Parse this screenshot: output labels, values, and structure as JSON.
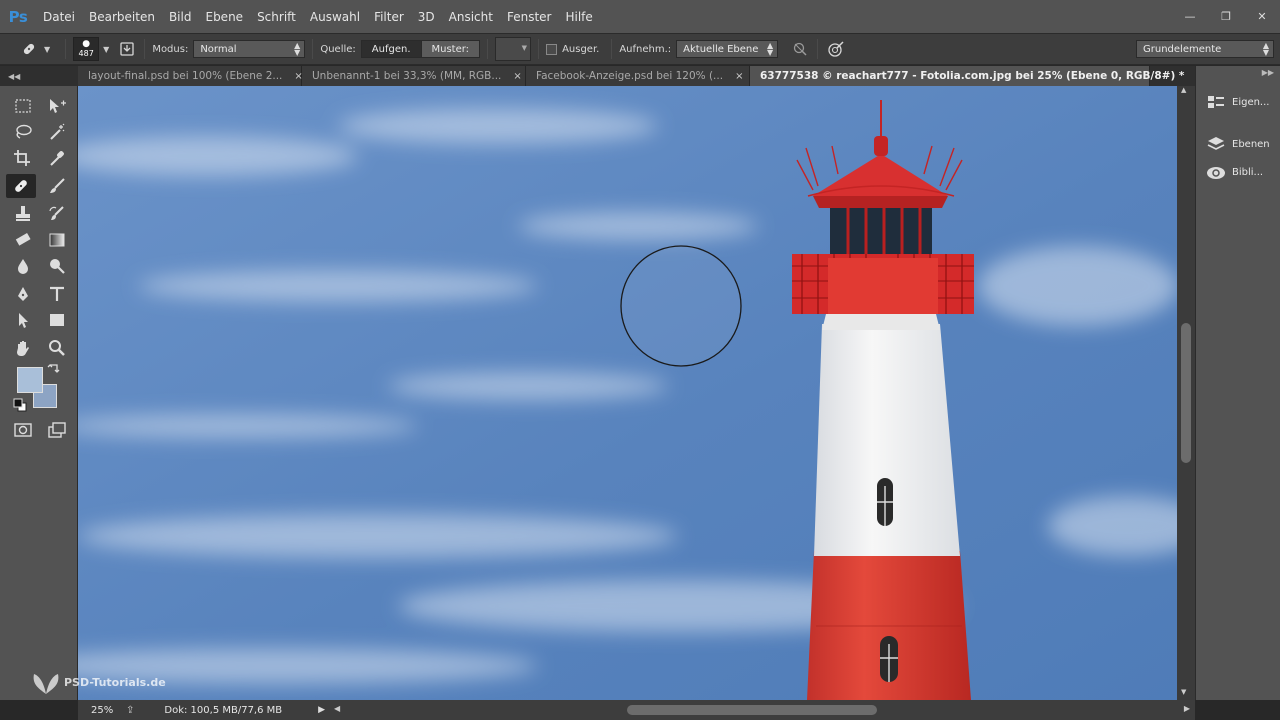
{
  "app": {
    "logo": "Ps"
  },
  "menu": [
    "Datei",
    "Bearbeiten",
    "Bild",
    "Ebene",
    "Schrift",
    "Auswahl",
    "Filter",
    "3D",
    "Ansicht",
    "Fenster",
    "Hilfe"
  ],
  "window_controls": {
    "minimize": "—",
    "maximize": "❐",
    "close": "✕"
  },
  "options": {
    "brush_size": "487",
    "mode_label": "Modus:",
    "mode_value": "Normal",
    "source_label": "Quelle:",
    "source_sampled": "Aufgen.",
    "source_pattern": "Muster:",
    "aligned_label": "Ausger.",
    "sample_label": "Aufnehm.:",
    "sample_value": "Aktuelle Ebene",
    "workspace": "Grundelemente"
  },
  "tabs": [
    {
      "label": "layout-final.psd bei 100% (Ebene 2...",
      "active": false
    },
    {
      "label": "Unbenannt-1 bei 33,3% (MM, RGB...",
      "active": false
    },
    {
      "label": "Facebook-Anzeige.psd bei 120% (...",
      "active": false
    },
    {
      "label": "63777538 © reachart777 - Fotolia.com.jpg bei 25% (Ebene 0, RGB/8#) *",
      "active": true
    }
  ],
  "tab_close": "×",
  "panels": [
    {
      "label": "Eigen...",
      "icon": "properties-icon"
    },
    {
      "label": "Ebenen",
      "icon": "layers-icon"
    },
    {
      "label": "Bibli...",
      "icon": "libraries-icon"
    }
  ],
  "status": {
    "zoom": "25%",
    "doc": "Dok: 100,5 MB/77,6 MB"
  },
  "watermark": "PSD-Tutorials.de",
  "colors": {
    "foreground": "#a9bfd9",
    "background": "#8da4c4",
    "accent_logo": "#3a8fd8"
  }
}
